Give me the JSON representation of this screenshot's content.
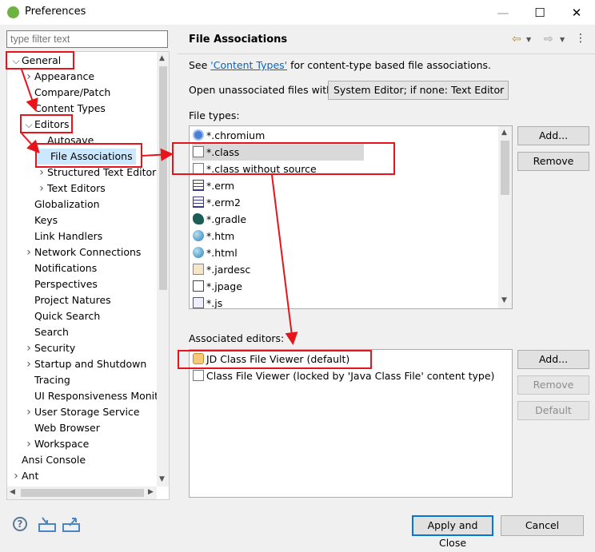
{
  "window": {
    "title": "Preferences",
    "min_glyph": "—",
    "max_glyph": "☐",
    "close_glyph": "✕"
  },
  "filter": {
    "placeholder": "type filter text"
  },
  "tree": {
    "items": [
      {
        "label": "General",
        "twisty": "open"
      },
      {
        "label": "Appearance",
        "twisty": "closed"
      },
      {
        "label": "Compare/Patch",
        "twisty": ""
      },
      {
        "label": "Content Types",
        "twisty": ""
      },
      {
        "label": "Editors",
        "twisty": "open"
      },
      {
        "label": "Autosave",
        "twisty": ""
      },
      {
        "label": "File Associations",
        "twisty": "",
        "selected": true
      },
      {
        "label": "Structured Text Editors",
        "twisty": "closed"
      },
      {
        "label": "Text Editors",
        "twisty": "closed"
      },
      {
        "label": "Globalization",
        "twisty": ""
      },
      {
        "label": "Keys",
        "twisty": ""
      },
      {
        "label": "Link Handlers",
        "twisty": ""
      },
      {
        "label": "Network Connections",
        "twisty": "closed"
      },
      {
        "label": "Notifications",
        "twisty": ""
      },
      {
        "label": "Perspectives",
        "twisty": ""
      },
      {
        "label": "Project Natures",
        "twisty": ""
      },
      {
        "label": "Quick Search",
        "twisty": ""
      },
      {
        "label": "Search",
        "twisty": ""
      },
      {
        "label": "Security",
        "twisty": "closed"
      },
      {
        "label": "Startup and Shutdown",
        "twisty": "closed"
      },
      {
        "label": "Tracing",
        "twisty": ""
      },
      {
        "label": "UI Responsiveness Monito",
        "twisty": ""
      },
      {
        "label": "User Storage Service",
        "twisty": "closed"
      },
      {
        "label": "Web Browser",
        "twisty": ""
      },
      {
        "label": "Workspace",
        "twisty": "closed"
      },
      {
        "label": "Ansi Console",
        "twisty": ""
      },
      {
        "label": "Ant",
        "twisty": "closed"
      }
    ]
  },
  "page": {
    "title": "File Associations",
    "see_prefix": "See ",
    "see_link": "'Content Types'",
    "see_suffix": " for content-type based file associations.",
    "open_label": "Open unassociated files with:",
    "open_value": "System Editor; if none: Text Editor",
    "file_types_label": "File types:",
    "file_types": [
      {
        "label": "*.chromium",
        "icon": "chromium-icon"
      },
      {
        "label": "*.class",
        "icon": "class-file-icon",
        "selected": true
      },
      {
        "label": "*.class without source",
        "icon": "class-file-icon"
      },
      {
        "label": "*.erm",
        "icon": "table-icon"
      },
      {
        "label": "*.erm2",
        "icon": "table-icon"
      },
      {
        "label": "*.gradle",
        "icon": "gradle-icon"
      },
      {
        "label": "*.htm",
        "icon": "globe-icon"
      },
      {
        "label": "*.html",
        "icon": "globe-icon"
      },
      {
        "label": "*.jardesc",
        "icon": "jar-icon"
      },
      {
        "label": "*.jpage",
        "icon": "java-page-icon"
      },
      {
        "label": "*.js",
        "icon": "js-file-icon"
      }
    ],
    "add_label": "Add...",
    "remove_label": "Remove",
    "assoc_label": "Associated editors:",
    "editors": [
      {
        "label": "JD Class File Viewer (default)",
        "icon": "jd-viewer-icon"
      },
      {
        "label": "Class File Viewer (locked by 'Java Class File' content type)",
        "icon": "class-viewer-icon"
      }
    ],
    "editors_add_label": "Add...",
    "editors_remove_label": "Remove",
    "default_label": "Default"
  },
  "footer": {
    "apply_close_label": "Apply and Close",
    "cancel_label": "Cancel"
  },
  "colors": {
    "annotation_red": "#e8141b",
    "selection": "#cce8ff",
    "link": "#0066cc"
  }
}
